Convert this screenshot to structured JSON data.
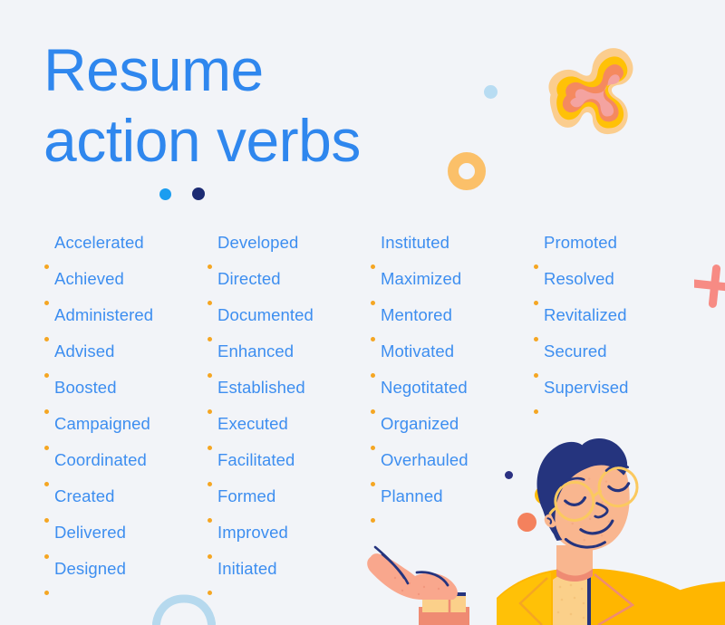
{
  "poster": {
    "background_color": "#f2f4f8",
    "title_lines": [
      "Resume",
      "action verbs"
    ],
    "title_color": "#2f87ee",
    "verb_text_color": "#3d8ef0",
    "bullet_color": "#f5a623"
  },
  "columns": [
    {
      "name": "column-1",
      "verbs": [
        "Accelerated",
        "Achieved",
        "Administered",
        "Advised",
        "Boosted",
        "Campaigned",
        "Coordinated",
        "Created",
        "Delivered",
        "Designed"
      ]
    },
    {
      "name": "column-2",
      "verbs": [
        "Developed",
        "Directed",
        "Documented",
        "Enhanced",
        "Established",
        "Executed",
        "Facilitated",
        "Formed",
        "Improved",
        "Initiated"
      ]
    },
    {
      "name": "column-3",
      "verbs": [
        "Instituted",
        "Maximized",
        "Mentored",
        "Motivated",
        "Negotitated",
        "Organized",
        "Overhauled",
        "Planned"
      ]
    },
    {
      "name": "column-4",
      "verbs": [
        "Promoted",
        "Resolved",
        "Revitalized",
        "Secured",
        "Supervised"
      ]
    }
  ],
  "decorations": {
    "blob": {
      "name": "orange-blob-shape",
      "colors": [
        "#fbcd8e",
        "#ffc107",
        "#f5895f",
        "#f4a3a0"
      ]
    },
    "ring": {
      "name": "orange-ring-shape",
      "color": "#fbc069"
    },
    "plus": {
      "name": "pink-plus-shape",
      "color": "#f78b84"
    },
    "arch": {
      "name": "blue-arch-shape",
      "color": "#b6d9ee"
    },
    "dots": [
      {
        "name": "blue-dot",
        "color": "#1b9df0"
      },
      {
        "name": "navy-dot",
        "color": "#1c2b73"
      },
      {
        "name": "pale-blue-dot",
        "color": "#b8dcf2"
      },
      {
        "name": "navy-small-dot",
        "color": "#2b3182"
      },
      {
        "name": "yellow-dot",
        "color": "#ffbc0a"
      },
      {
        "name": "salmon-dot",
        "color": "#f4815d"
      }
    ]
  },
  "illustration": {
    "name": "smiling-person-with-open-hand",
    "hair_color": "#25347e",
    "skin_color": "#f9b68f",
    "jacket_color": "#ffb600",
    "shirt_color": "#fbd08a",
    "glasses_color": "#fbc95f",
    "hand_color": "#f9a78d"
  }
}
